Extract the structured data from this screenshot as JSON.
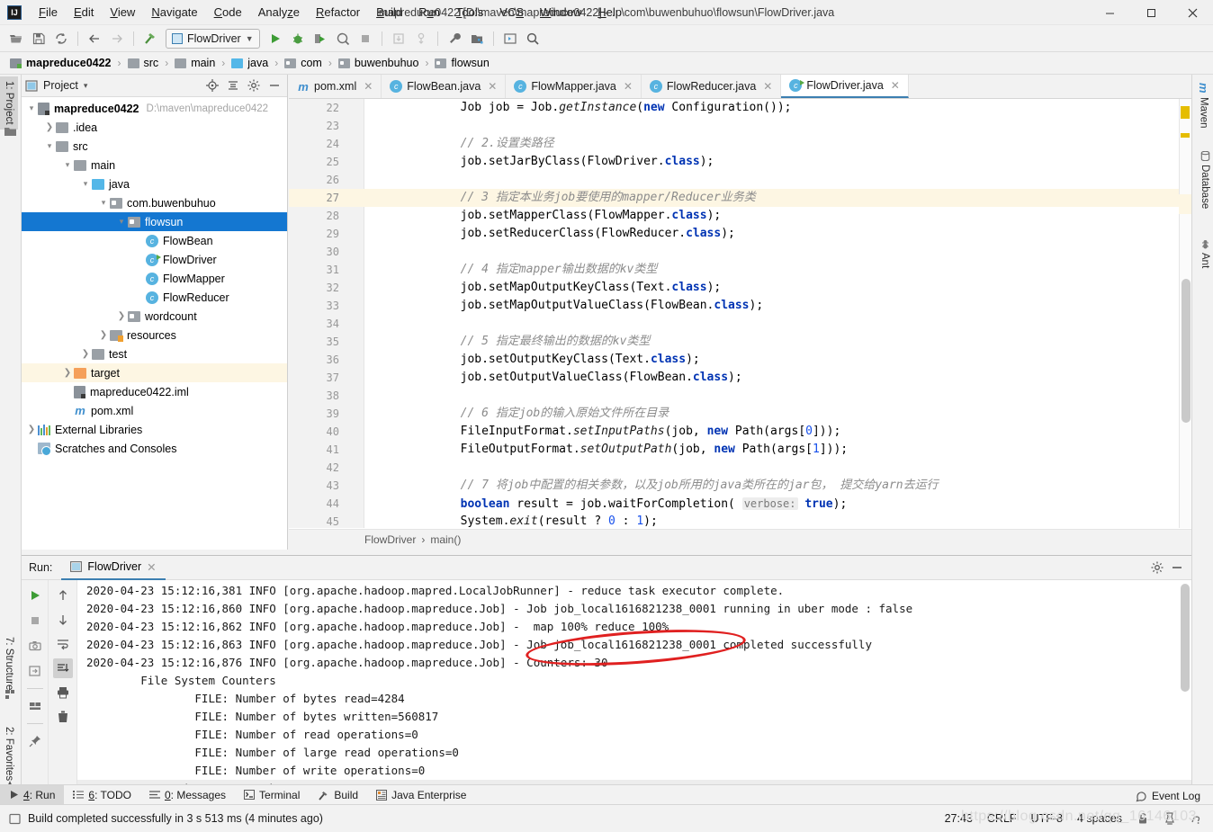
{
  "window": {
    "title": "mapreduce0422 [D:\\maven\\mapreduce0422] - ...\\com\\buwenbuhuo\\flowsun\\FlowDriver.java",
    "minimize": "—",
    "maximize": "☐",
    "close": "✕"
  },
  "menu": {
    "items": [
      "File",
      "Edit",
      "View",
      "Navigate",
      "Code",
      "Analyze",
      "Refactor",
      "Build",
      "Run",
      "Tools",
      "VCS",
      "Window",
      "Help"
    ]
  },
  "toolbar": {
    "run_config": "FlowDriver",
    "icons": [
      "open-icon",
      "save-icon",
      "sync-icon",
      "back-icon",
      "forward-icon",
      "build-icon",
      "run-icon",
      "debug-icon",
      "run-coverage-icon",
      "profile-icon",
      "stop-icon",
      "update-icon",
      "commit-icon",
      "settings-wrench-icon",
      "project-structure-icon",
      "run-anything-icon",
      "search-everywhere-icon"
    ]
  },
  "breadcrumb": {
    "items": [
      {
        "label": "mapreduce0422",
        "icon": "module-icon"
      },
      {
        "label": "src",
        "icon": "folder-icon"
      },
      {
        "label": "main",
        "icon": "folder-icon"
      },
      {
        "label": "java",
        "icon": "source-folder-icon"
      },
      {
        "label": "com",
        "icon": "package-icon"
      },
      {
        "label": "buwenbuhuo",
        "icon": "package-icon"
      },
      {
        "label": "flowsun",
        "icon": "package-icon"
      }
    ],
    "separator": "›"
  },
  "left_strip": {
    "tabs": [
      {
        "label": "1: Project",
        "selected": true,
        "icon": "project-icon"
      },
      {
        "label": "7: Structure",
        "selected": false,
        "icon": "structure-icon"
      },
      {
        "label": "2: Favorites",
        "selected": false,
        "icon": "star-icon"
      }
    ]
  },
  "right_strip": {
    "tabs": [
      {
        "label": "Maven",
        "icon": "maven-icon"
      },
      {
        "label": "Database",
        "icon": "database-icon"
      },
      {
        "label": "Ant",
        "icon": "ant-icon"
      }
    ]
  },
  "project_panel": {
    "title": "Project",
    "dropdown_caret": "▾",
    "header_icons": [
      "locate-icon",
      "collapse-all-icon",
      "gear-icon",
      "hide-icon"
    ],
    "tree": [
      {
        "depth": 0,
        "arrow": "▾",
        "icon": "module-icon",
        "label": "mapreduce0422",
        "bold": true,
        "path": "D:\\maven\\mapreduce0422"
      },
      {
        "depth": 1,
        "arrow": "❯",
        "icon": "folder-icon",
        "label": ".idea"
      },
      {
        "depth": 1,
        "arrow": "▾",
        "icon": "folder-icon",
        "label": "src"
      },
      {
        "depth": 2,
        "arrow": "▾",
        "icon": "folder-icon",
        "label": "main"
      },
      {
        "depth": 3,
        "arrow": "▾",
        "icon": "source-folder-icon",
        "label": "java"
      },
      {
        "depth": 4,
        "arrow": "▾",
        "icon": "package-icon",
        "label": "com.buwenbuhuo"
      },
      {
        "depth": 5,
        "arrow": "▾",
        "icon": "package-icon",
        "label": "flowsun",
        "selected": true
      },
      {
        "depth": 6,
        "arrow": "",
        "icon": "class-icon",
        "label": "FlowBean"
      },
      {
        "depth": 6,
        "arrow": "",
        "icon": "runnable-class-icon",
        "label": "FlowDriver"
      },
      {
        "depth": 6,
        "arrow": "",
        "icon": "class-icon",
        "label": "FlowMapper"
      },
      {
        "depth": 6,
        "arrow": "",
        "icon": "class-icon",
        "label": "FlowReducer"
      },
      {
        "depth": 5,
        "arrow": "❯",
        "icon": "package-icon",
        "label": "wordcount"
      },
      {
        "depth": 4,
        "arrow": "❯",
        "icon": "resources-folder-icon",
        "label": "resources"
      },
      {
        "depth": 3,
        "arrow": "❯",
        "icon": "folder-icon",
        "label": "test"
      },
      {
        "depth": 2,
        "arrow": "❯",
        "icon": "target-folder-icon",
        "label": "target",
        "highlight": true
      },
      {
        "depth": 2,
        "arrow": "",
        "icon": "iml-file-icon",
        "label": "mapreduce0422.iml"
      },
      {
        "depth": 2,
        "arrow": "",
        "icon": "maven-pom-icon",
        "label": "pom.xml"
      },
      {
        "depth": 0,
        "arrow": "❯",
        "icon": "libraries-icon",
        "label": "External Libraries"
      },
      {
        "depth": 0,
        "arrow": "",
        "icon": "scratches-icon",
        "label": "Scratches and Consoles"
      }
    ]
  },
  "editor": {
    "tabs": [
      {
        "label": "pom.xml",
        "icon": "maven-pom-icon",
        "active": false
      },
      {
        "label": "FlowBean.java",
        "icon": "class-icon",
        "active": false
      },
      {
        "label": "FlowMapper.java",
        "icon": "class-icon",
        "active": false
      },
      {
        "label": "FlowReducer.java",
        "icon": "class-icon",
        "active": false
      },
      {
        "label": "FlowDriver.java",
        "icon": "runnable-class-icon",
        "active": true
      }
    ],
    "close_glyph": "✕",
    "lines": [
      {
        "n": 22,
        "html": "        Job job = Job.<i class='mi'>getInstance</i>(<b class='kw'>new </b>Configuration());"
      },
      {
        "n": 23,
        "html": ""
      },
      {
        "n": 24,
        "html": "        <span class='cm'>// 2.设置类路径</span>"
      },
      {
        "n": 25,
        "html": "        job.setJarByClass(FlowDriver.<b class='kw'>class</b>);"
      },
      {
        "n": 26,
        "html": ""
      },
      {
        "n": 27,
        "html": "        <span class='cm'>// 3 指定本业务job要使用的mapper/Reducer业务类</span>",
        "highlight": true
      },
      {
        "n": 28,
        "html": "        job.setMapperClass(FlowMapper.<b class='kw'>class</b>);"
      },
      {
        "n": 29,
        "html": "        job.setReducerClass(FlowReducer.<b class='kw'>class</b>);"
      },
      {
        "n": 30,
        "html": ""
      },
      {
        "n": 31,
        "html": "        <span class='cm'>// 4 指定mapper输出数据的kv类型</span>"
      },
      {
        "n": 32,
        "html": "        job.setMapOutputKeyClass(Text.<b class='kw'>class</b>);"
      },
      {
        "n": 33,
        "html": "        job.setMapOutputValueClass(FlowBean.<b class='kw'>class</b>);"
      },
      {
        "n": 34,
        "html": ""
      },
      {
        "n": 35,
        "html": "        <span class='cm'>// 5 指定最终输出的数据的kv类型</span>"
      },
      {
        "n": 36,
        "html": "        job.setOutputKeyClass(Text.<b class='kw'>class</b>);"
      },
      {
        "n": 37,
        "html": "        job.setOutputValueClass(FlowBean.<b class='kw'>class</b>);"
      },
      {
        "n": 38,
        "html": ""
      },
      {
        "n": 39,
        "html": "        <span class='cm'>// 6 指定job的输入原始文件所在目录</span>"
      },
      {
        "n": 40,
        "html": "        FileInputFormat.<i class='mi'>setInputPaths</i>(job, <b class='kw'>new </b>Path(args[<span class='num'>0</span>]));"
      },
      {
        "n": 41,
        "html": "        FileOutputFormat.<i class='mi'>setOutputPath</i>(job, <b class='kw'>new </b>Path(args[<span class='num'>1</span>]));"
      },
      {
        "n": 42,
        "html": ""
      },
      {
        "n": 43,
        "html": "        <span class='cm'>// 7 将job中配置的相关参数，以及job所用的java类所在的jar包， 提交给yarn去运行</span>"
      },
      {
        "n": 44,
        "html": "        <b class='kw'>boolean </b>result = job.waitForCompletion( <span class='hint'>verbose:</span> <b class='kw'>true</b>);"
      },
      {
        "n": 45,
        "html": "        System.<i class='mi'>exit</i>(result ? <span class='num'>0</span> : <span class='num'>1</span>);"
      }
    ],
    "breadcrumb": [
      "FlowDriver",
      "main()"
    ],
    "breadcrumb_sep": "›"
  },
  "run_panel": {
    "label": "Run:",
    "tab": "FlowDriver",
    "close_glyph": "✕",
    "header_icons": [
      "gear-icon",
      "minimize-icon"
    ],
    "left_tools": [
      "rerun-icon",
      "stop-icon",
      "dump-threads-icon",
      "restore-layout-icon",
      "console-icon",
      "pin-icon"
    ],
    "left_tools2": [
      "up-arrow-icon",
      "down-arrow-icon",
      "soft-wrap-icon",
      "scroll-to-end-icon",
      "print-icon",
      "clear-all-icon"
    ],
    "console_lines": [
      {
        "text": "2020-04-23 15:12:16,381 INFO [org.apache.hadoop.mapred.LocalJobRunner] - reduce task executor complete."
      },
      {
        "text": "2020-04-23 15:12:16,860 INFO [org.apache.hadoop.mapreduce.Job] - Job job_local1616821238_0001 running in uber mode : false"
      },
      {
        "text": "2020-04-23 15:12:16,862 INFO [org.apache.hadoop.mapreduce.Job] -  map 100% reduce 100%"
      },
      {
        "text": "2020-04-23 15:12:16,863 INFO [org.apache.hadoop.mapreduce.Job] - Job job_local1616821238_0001 completed successfully"
      },
      {
        "text": "2020-04-23 15:12:16,876 INFO [org.apache.hadoop.mapreduce.Job] - Counters: 30"
      },
      {
        "text": "        File System Counters"
      },
      {
        "text": "                FILE: Number of bytes read=4284"
      },
      {
        "text": "                FILE: Number of bytes written=560817"
      },
      {
        "text": "                FILE: Number of read operations=0"
      },
      {
        "text": "                FILE: Number of large read operations=0"
      },
      {
        "text": "                FILE: Number of write operations=0"
      },
      {
        "text": "        Map-Reduce Framework",
        "folded": true
      }
    ],
    "annotation_color": "#e02020"
  },
  "bottom_tabs": [
    {
      "label": "4: Run",
      "icon": "run-icon",
      "selected": true
    },
    {
      "label": "6: TODO",
      "icon": "todo-icon",
      "selected": false
    },
    {
      "label": "0: Messages",
      "icon": "messages-icon",
      "selected": false
    },
    {
      "label": "Terminal",
      "icon": "terminal-icon",
      "selected": false
    },
    {
      "label": "Build",
      "icon": "build-icon",
      "selected": false
    },
    {
      "label": "Java Enterprise",
      "icon": "java-enterprise-icon",
      "selected": false
    }
  ],
  "status_bar": {
    "message": "Build completed successfully in 3 s 513 ms (4 minutes ago)",
    "caret_position": "27:43",
    "line_separator": "CRLF",
    "encoding": "UTF-8",
    "indent": "4 spaces",
    "icons": [
      "lock-icon",
      "inspection-icon",
      "hector-icon"
    ],
    "event_log": "Event Log",
    "watermark": "https://blog.csdn.net/qq_16146103"
  },
  "colors": {
    "accent_blue": "#1477d1",
    "tab_underline": "#3c7fb1",
    "annotation_red": "#e02020",
    "warning_yellow": "#e5bd00",
    "highlight_row": "#fdf6e3",
    "keyword_blue": "#0033b3",
    "comment_gray": "#8c8c8c"
  }
}
